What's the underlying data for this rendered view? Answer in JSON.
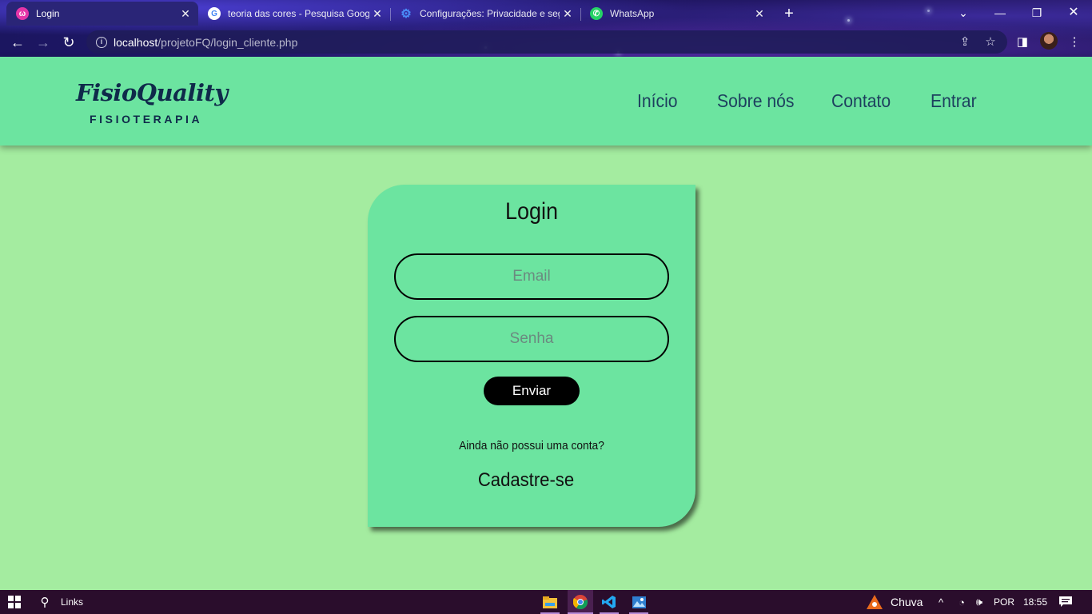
{
  "browser": {
    "tabs": [
      {
        "title": "Login",
        "favicon": "app-icon",
        "color": "#e535a8",
        "active": true
      },
      {
        "title": "teoria das cores - Pesquisa Goog",
        "favicon": "google-icon",
        "color": "#4285f4",
        "active": false
      },
      {
        "title": "Configurações: Privacidade e seg",
        "favicon": "settings-icon",
        "color": "#4a8cf7",
        "active": false
      },
      {
        "title": "WhatsApp",
        "favicon": "whatsapp-icon",
        "color": "#25d366",
        "active": false
      }
    ],
    "url_host": "localhost",
    "url_path": "/projetoFQ/login_cliente.php"
  },
  "site": {
    "logo_title": "FisioQuality",
    "logo_subtitle": "FISIOTERAPIA",
    "nav": [
      "Início",
      "Sobre nós",
      "Contato",
      "Entrar"
    ]
  },
  "login": {
    "title": "Login",
    "email_placeholder": "Email",
    "password_placeholder": "Senha",
    "submit_label": "Enviar",
    "no_account_text": "Ainda não possui uma conta?",
    "signup_label": "Cadastre-se"
  },
  "taskbar": {
    "search_label": "Links",
    "weather_label": "Chuva",
    "language": "POR",
    "time": "18:55"
  },
  "colors": {
    "page_bg": "#a4eca0",
    "header_bg": "#6ce4a0",
    "card_bg": "#6ce4a0",
    "button_bg": "#000000"
  }
}
